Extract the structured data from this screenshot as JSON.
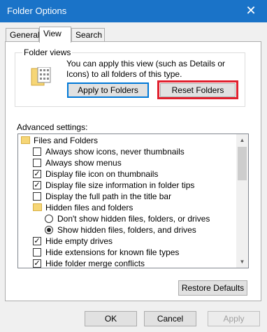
{
  "window": {
    "title": "Folder Options",
    "close_glyph": "✕"
  },
  "tabs": [
    {
      "label": "General",
      "active": false
    },
    {
      "label": "View",
      "active": true
    },
    {
      "label": "Search",
      "active": false
    }
  ],
  "folder_views": {
    "title": "Folder views",
    "description": "You can apply this view (such as Details or Icons) to all folders of this type.",
    "apply_button": "Apply to Folders",
    "reset_button": "Reset Folders",
    "icon": "folder-views-icon"
  },
  "advanced": {
    "label": "Advanced settings:",
    "items": [
      {
        "type": "folder",
        "label": "Files and Folders",
        "level": 0
      },
      {
        "type": "checkbox",
        "label": "Always show icons, never thumbnails",
        "checked": false,
        "level": 1
      },
      {
        "type": "checkbox",
        "label": "Always show menus",
        "checked": false,
        "level": 1
      },
      {
        "type": "checkbox",
        "label": "Display file icon on thumbnails",
        "checked": true,
        "level": 1
      },
      {
        "type": "checkbox",
        "label": "Display file size information in folder tips",
        "checked": true,
        "level": 1
      },
      {
        "type": "checkbox",
        "label": "Display the full path in the title bar",
        "checked": false,
        "level": 1
      },
      {
        "type": "folder",
        "label": "Hidden files and folders",
        "level": 1
      },
      {
        "type": "radio",
        "label": "Don't show hidden files, folders, or drives",
        "checked": false,
        "level": 2
      },
      {
        "type": "radio",
        "label": "Show hidden files, folders, and drives",
        "checked": true,
        "level": 2
      },
      {
        "type": "checkbox",
        "label": "Hide empty drives",
        "checked": true,
        "level": 1
      },
      {
        "type": "checkbox",
        "label": "Hide extensions for known file types",
        "checked": false,
        "level": 1
      },
      {
        "type": "checkbox",
        "label": "Hide folder merge conflicts",
        "checked": true,
        "level": 1
      }
    ]
  },
  "restore_button": "Restore Defaults",
  "footer": {
    "ok": "OK",
    "cancel": "Cancel",
    "apply": "Apply"
  },
  "colors": {
    "titlebar": "#1a73c8",
    "highlight": "#e0202e",
    "focus": "#0078d7"
  }
}
